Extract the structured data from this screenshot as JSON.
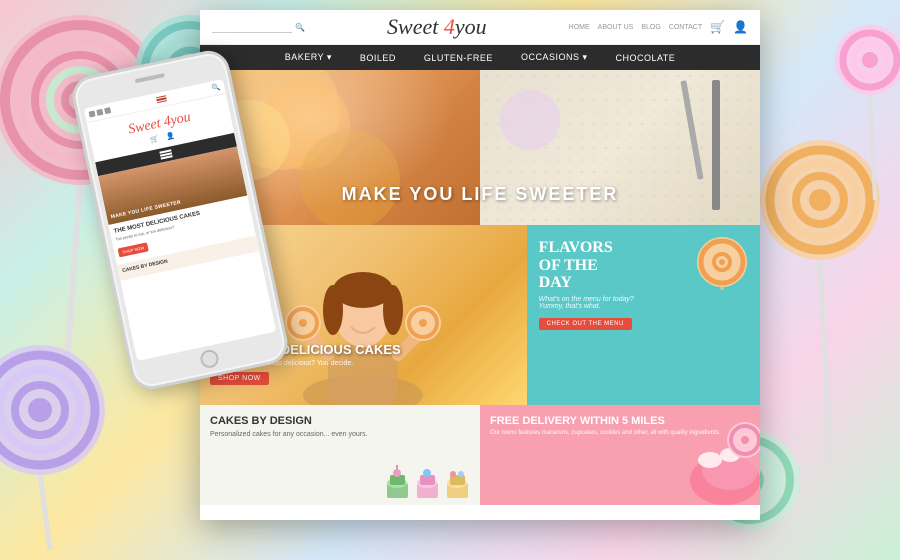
{
  "brand": {
    "name_part1": "Sweet",
    "name_number": "4",
    "name_part2": "you"
  },
  "desktop": {
    "top_links": [
      "HOME",
      "ABOUT US",
      "BLOG",
      "CONTACT"
    ],
    "search_placeholder": "",
    "nav_items": [
      "BAKERY",
      "BOILED",
      "GLUTEN-FREE",
      "OCCASIONS",
      "CHOCOLATE"
    ],
    "hero_text": "MAKE YOU LIFE SWEETER",
    "mid_section": {
      "title": "THE MOST DELICIOUS CAKES",
      "subtitle": "Too pretty to eat, or too delicious? You decide.",
      "shop_btn": "SHOP NOW"
    },
    "flavors": {
      "title": "FLAVORS\nOF THE\nDAY",
      "subtitle": "What's on the menu for today? Yummy, that's what.",
      "btn_label": "CHECK OUT THE MENU"
    },
    "cakes_by_design": {
      "title": "CAKES BY DESIGN",
      "subtitle": "Personalized cakes for any occasion... even yours."
    },
    "free_delivery": {
      "title": "FREE DELIVERY WITHIN 5 MILES",
      "subtitle": "Our menu features macarons, cupcakes, cookies and other, all with quality ingredients."
    }
  },
  "phone": {
    "logo_text": "Sweet 4 you",
    "hero_text": "MAKE YOU LIFE SWEETER",
    "section_title": "THE MOST DELICIOUS CAKES",
    "section_sub": "Too pretty to eat, or too delicious?",
    "shop_btn": "SHOP NOW",
    "cakes_title": "CAKES BY DESIGN"
  },
  "colors": {
    "accent_red": "#e74c3c",
    "nav_dark": "#2c2c2c",
    "teal": "#5bc8c8",
    "pink": "#f9a0b0",
    "cream": "#f5f5f0"
  }
}
